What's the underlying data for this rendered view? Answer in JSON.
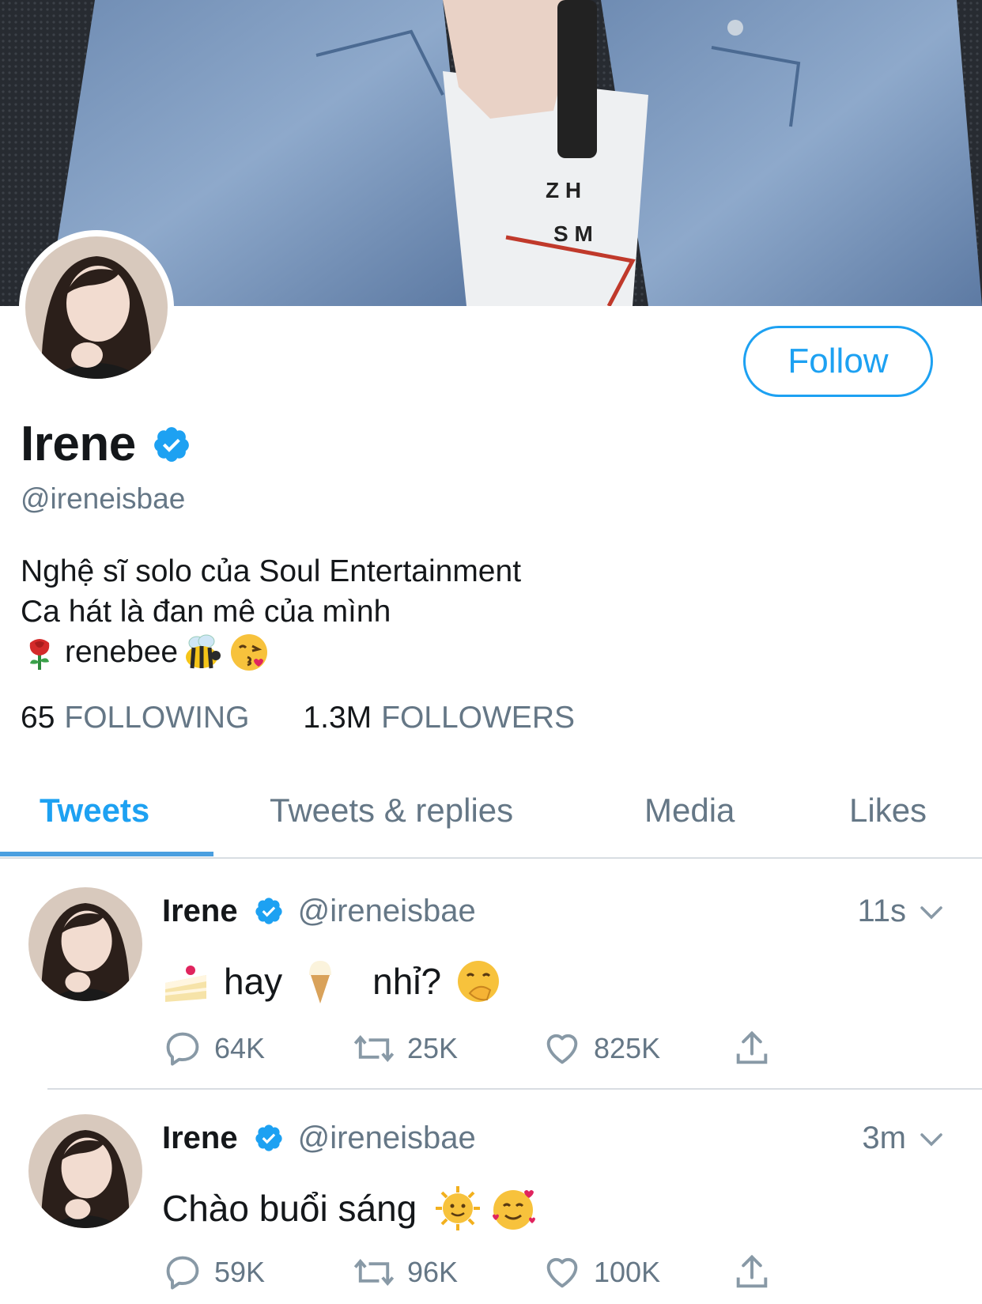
{
  "profile": {
    "name": "Irene",
    "handle": "@ireneisbae",
    "follow_label": "Follow",
    "bio": {
      "line1": "Nghệ sĩ solo của Soul Entertainment",
      "line2": "Ca hát là đan mê của mình",
      "line3_text": "renebee"
    },
    "stats": {
      "following_count": "65",
      "following_label": "FOLLOWING",
      "followers_count": "1.3M",
      "followers_label": "FOLLOWERS"
    }
  },
  "tabs": [
    {
      "label": "Tweets",
      "active": true
    },
    {
      "label": "Tweets & replies",
      "active": false
    },
    {
      "label": "Media",
      "active": false
    },
    {
      "label": "Likes",
      "active": false
    }
  ],
  "tweets": [
    {
      "name": "Irene",
      "handle": "@ireneisbae",
      "time": "11s",
      "text_parts": [
        "hay",
        "nhỉ?"
      ],
      "emojis": [
        "cake-emoji",
        "ice-cream-emoji",
        "hand-over-mouth-emoji"
      ],
      "replies": "64K",
      "retweets": "25K",
      "likes": "825K"
    },
    {
      "name": "Irene",
      "handle": "@ireneisbae",
      "time": "3m",
      "text": "Chào buổi sáng",
      "emojis": [
        "sun-face-emoji",
        "smiling-face-hearts-emoji"
      ],
      "replies": "59K",
      "retweets": "96K",
      "likes": "100K"
    }
  ],
  "colors": {
    "accent": "#1da1f2",
    "secondary_text": "#657786",
    "verified": "#1da1f2"
  }
}
